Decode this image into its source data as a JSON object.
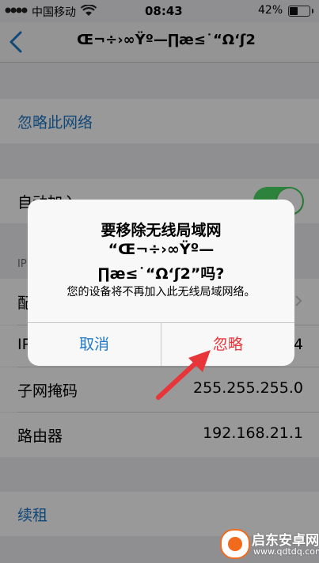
{
  "status_bar": {
    "carrier": "中国移动",
    "time": "08:43",
    "battery": "42%"
  },
  "nav": {
    "title": "Œ¬÷›∞Ÿº—∏æ≤˙“Ω‘ʃ2"
  },
  "rows": {
    "forget": "忽略此网络",
    "auto_join": "自动加入",
    "ip_header": "IP",
    "configure": "配",
    "ip_label": "IP",
    "ip_value_tail": "4",
    "subnet_label": "子网掩码",
    "subnet_value": "255.255.255.0",
    "router_label": "路由器",
    "router_value": "192.168.21.1",
    "renew": "续租"
  },
  "alert": {
    "title_line1": "要移除无线局域网",
    "title_line2": "“Œ¬÷›∞Ÿº—",
    "title_line3": "∏æ≤˙“Ω‘ʃ2”吗?",
    "message": "您的设备将不再加入此无线局域网络。",
    "cancel": "取消",
    "ignore": "忽略"
  },
  "watermark": {
    "brand": "启东安卓网",
    "url": "www.qdtdq.com"
  },
  "colors": {
    "blue": "#1d78c9",
    "red": "#e8353a",
    "green": "#4cd964",
    "orange": "#f26b1d"
  }
}
